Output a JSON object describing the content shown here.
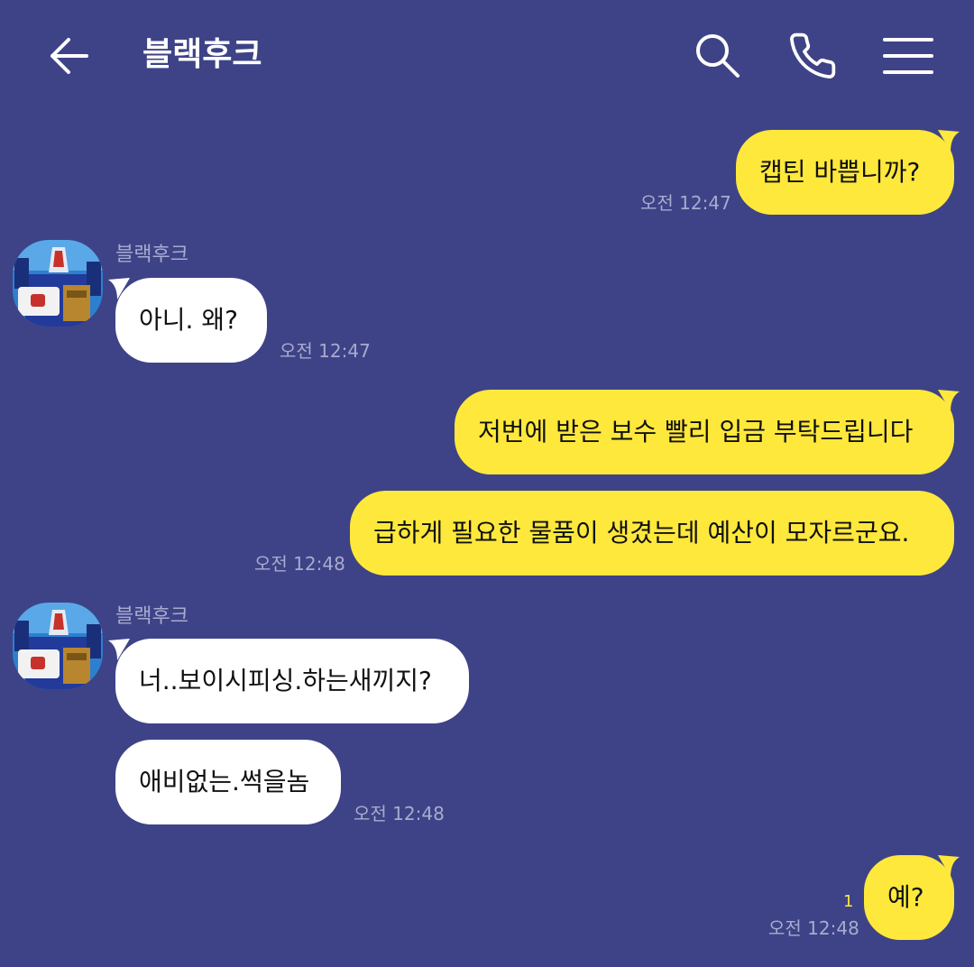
{
  "header": {
    "title": "블랙후크",
    "back_icon": "arrow-left-icon",
    "search_icon": "search-icon",
    "call_icon": "phone-icon",
    "menu_icon": "hamburger-menu-icon"
  },
  "colors": {
    "background": "#3e4387",
    "my_bubble": "#fee83c",
    "their_bubble": "#ffffff",
    "meta_text": "#a8abcf",
    "unread_count": "#fee83c"
  },
  "messages": [
    {
      "sender": "me",
      "text": "캡틴 바쁩니까?",
      "time": "오전 12:47"
    },
    {
      "sender": "블랙후크",
      "name": "블랙후크",
      "text": "아니. 왜?",
      "time": "오전 12:47"
    },
    {
      "sender": "me",
      "text": "저번에 받은 보수 빨리 입금 부탁드립니다"
    },
    {
      "sender": "me",
      "text": "급하게 필요한 물품이 생겼는데 예산이 모자르군요.",
      "time": "오전 12:48"
    },
    {
      "sender": "블랙후크",
      "name": "블랙후크",
      "text": "너..보이시피싱.하는새끼지?"
    },
    {
      "sender": "블랙후크",
      "text": "애비없는.썩을놈",
      "time": "오전 12:48"
    },
    {
      "sender": "me",
      "text": "예?",
      "time": "오전 12:48",
      "unread": "1"
    }
  ]
}
